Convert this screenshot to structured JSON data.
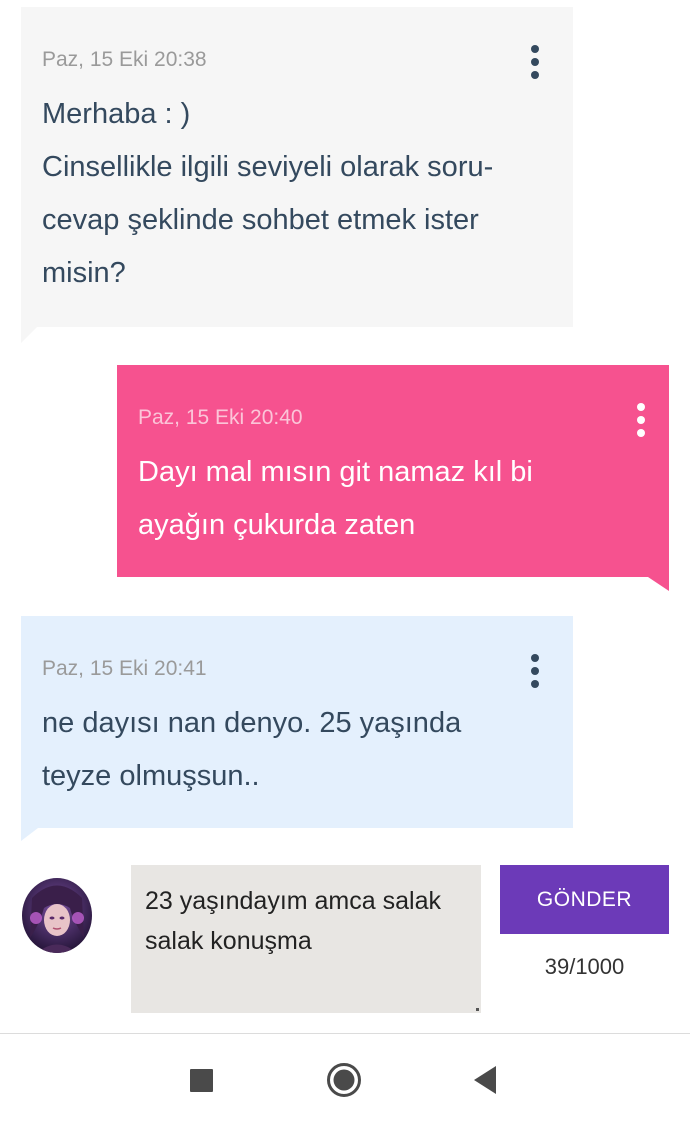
{
  "messages": [
    {
      "time": "Paz, 15 Eki 20:38",
      "text": "Merhaba : )\nCinsellikle ilgili seviyeli olarak soru-\ncevap şeklinde sohbet etmek ister\nmisin?",
      "direction": "incoming",
      "color": "#f6f6f6"
    },
    {
      "time": "Paz, 15 Eki 20:40",
      "text": "Dayı mal mısın git namaz kıl bi\nayağın çukurda zaten",
      "direction": "outgoing",
      "color": "#f6528f"
    },
    {
      "time": "Paz, 15 Eki 20:41",
      "text": "ne dayısı nan denyo. 25 yaşında\nteyze olmuşsun..",
      "direction": "incoming",
      "color": "#e4f0fd"
    }
  ],
  "composer": {
    "value": "23 yaşındayım amca salak\nsalak konuşma",
    "send_label": "GÖNDER",
    "counter": "39/1000",
    "send_color": "#6c3ab8"
  },
  "navbar": {
    "icons": [
      "recent-apps-icon",
      "home-icon",
      "back-icon"
    ]
  }
}
